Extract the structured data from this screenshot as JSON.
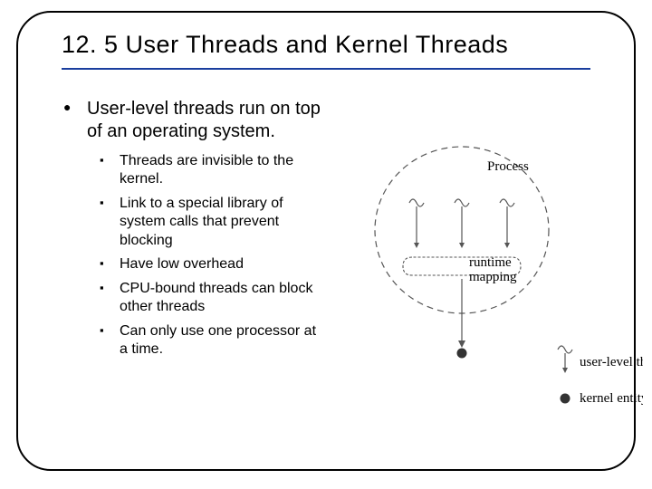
{
  "title": "12. 5 User Threads and Kernel Threads",
  "main_bullet": "User-level threads run on top of an operating system.",
  "sub_bullets": [
    "Threads are invisible to the kernel.",
    "Link to a special library of system calls that prevent blocking",
    "Have low overhead",
    "CPU-bound threads can block other threads",
    "Can only use one processor at a time."
  ],
  "diagram": {
    "process_label": "Process",
    "runtime_label_line1": "runtime",
    "runtime_label_line2": "mapping",
    "legend_user_thread": "user-level thread",
    "legend_kernel_entity": "kernel entity"
  }
}
